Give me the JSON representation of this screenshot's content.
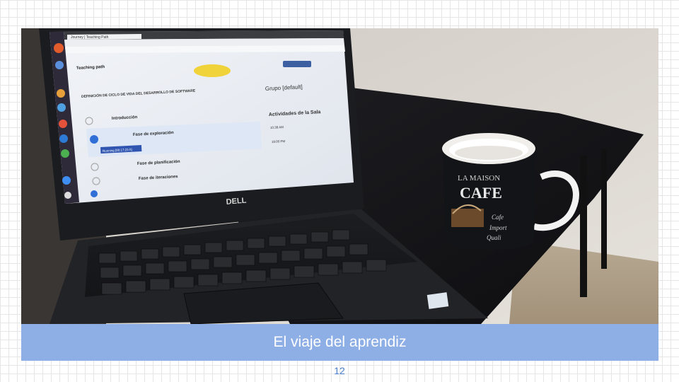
{
  "slide": {
    "caption": "El viaje del aprendiz",
    "page_number": "12"
  },
  "photo": {
    "laptop_brand": "DELL",
    "mug_text": [
      "LA MAISON",
      "CAFE",
      "Cafe",
      "Import",
      "Quali"
    ],
    "screen": {
      "tab_title": "Journey | Teaching Path",
      "logo": "Teaching path",
      "section_title": "DEFINICIÓN DE CICLO DE VIDA DEL DESARROLLO DE SOFTWARE",
      "group_title": "Grupo [default]",
      "activities_title": "Actividades de la Sala",
      "steps": [
        "Introducción",
        "Fase de exploración",
        "Fase de planificación",
        "Fase de iteraciones"
      ],
      "running_label": "Running [00:17:23 h]",
      "times": [
        "10:38 AM",
        "19:00 PM"
      ]
    }
  }
}
